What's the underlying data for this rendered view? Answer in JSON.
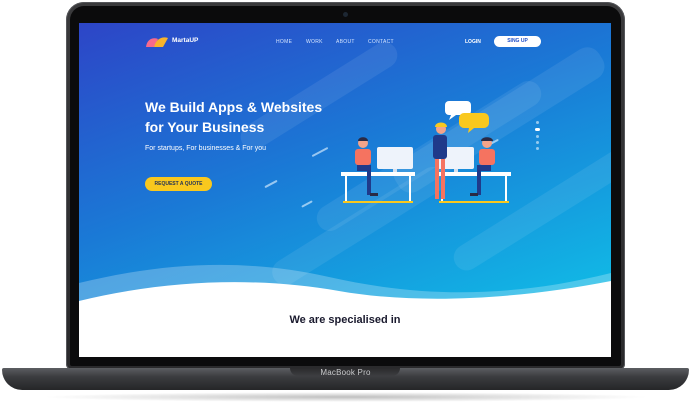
{
  "device": {
    "model_label": "MacBook Pro"
  },
  "nav": {
    "brand": "MartaUP",
    "links": [
      "HOME",
      "WORK",
      "ABOUT",
      "CONTACT"
    ],
    "login": "LOGIN",
    "signup": "SING UP"
  },
  "hero": {
    "headline_line1": "We Build Apps & Websites",
    "headline_line2": "for Your Business",
    "subline": "For startups, For businesses & For you",
    "cta": "REQUEST A QUOTE"
  },
  "slider": {
    "dot_count": 5,
    "active_index": 1
  },
  "section": {
    "title": "We are specialised in"
  },
  "colors": {
    "hero_top": "#2d45c7",
    "hero_bottom": "#0fc3e8",
    "cta": "#f9c81e",
    "signup_text": "#2250c8"
  }
}
